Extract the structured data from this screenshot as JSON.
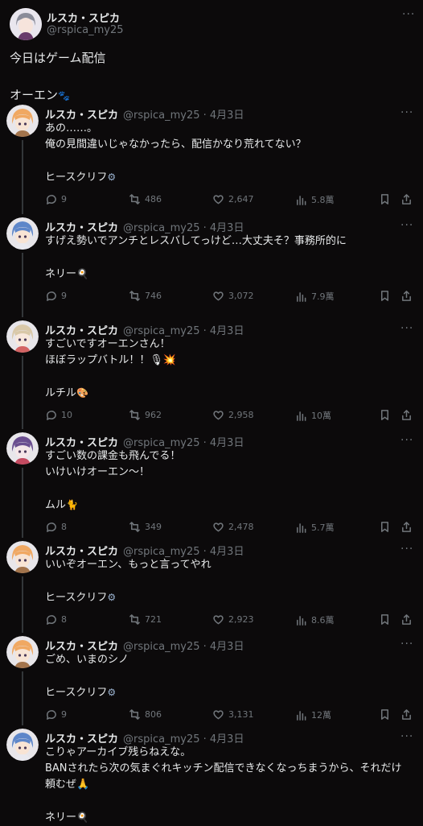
{
  "main": {
    "name": "ルスカ・スピカ",
    "handle": "@rspica_my25",
    "line1": "今日はゲーム配信",
    "line2": "オーエン",
    "line2_emoji": "🐾"
  },
  "replies": [
    {
      "name": "ルスカ・スピカ",
      "meta": "@rspica_my25 · 4月3日",
      "lines": [
        "あの……。",
        "俺の見間違いじゃなかったら、配信かなり荒れてない？"
      ],
      "sig": "ヒースクリフ",
      "sig_icon": "gear-icon",
      "sig_glyph": "⚙",
      "counts": {
        "reply": "9",
        "repost": "486",
        "like": "2,647",
        "views": "5.8萬"
      }
    },
    {
      "name": "ルスカ・スピカ",
      "meta": "@rspica_my25 · 4月3日",
      "lines": [
        "すげえ勢いでアンチとレスバしてっけど…大丈夫そ？事務所的に"
      ],
      "sig": "ネリー",
      "sig_icon": "fried-egg-icon",
      "sig_glyph": "🍳",
      "counts": {
        "reply": "9",
        "repost": "746",
        "like": "3,072",
        "views": "7.9萬"
      }
    },
    {
      "name": "ルスカ・スピカ",
      "meta": "@rspica_my25 · 4月3日",
      "lines": [
        "すごいですオーエンさん！",
        "ほぼラップバトル！！🎙💥"
      ],
      "sig": "ルチル",
      "sig_icon": "palette-icon",
      "sig_glyph": "🎨",
      "counts": {
        "reply": "10",
        "repost": "962",
        "like": "2,958",
        "views": "10萬"
      }
    },
    {
      "name": "ルスカ・スピカ",
      "meta": "@rspica_my25 · 4月3日",
      "lines": [
        "すごい数の課金も飛んでる！",
        "いけいけオーエン〜！"
      ],
      "sig": "ムル",
      "sig_icon": "black-cat-icon",
      "sig_glyph": "🐈",
      "counts": {
        "reply": "8",
        "repost": "349",
        "like": "2,478",
        "views": "5.7萬"
      }
    },
    {
      "name": "ルスカ・スピカ",
      "meta": "@rspica_my25 · 4月3日",
      "lines": [
        "いいぞオーエン、もっと言ってやれ"
      ],
      "sig": "ヒースクリフ",
      "sig_icon": "gear-icon",
      "sig_glyph": "⚙",
      "counts": {
        "reply": "8",
        "repost": "721",
        "like": "2,923",
        "views": "8.6萬"
      }
    },
    {
      "name": "ルスカ・スピカ",
      "meta": "@rspica_my25 · 4月3日",
      "lines": [
        "ごめ、いまのシノ"
      ],
      "sig": "ヒースクリフ",
      "sig_icon": "gear-icon",
      "sig_glyph": "⚙",
      "counts": {
        "reply": "9",
        "repost": "806",
        "like": "3,131",
        "views": "12萬"
      }
    },
    {
      "name": "ルスカ・スピカ",
      "meta": "@rspica_my25 · 4月3日",
      "lines": [
        "こりゃアーカイブ残らねえな。",
        "BANされたら次の気まぐれキッチン配信できなくなっちまうから、それだけ",
        "頼むぜ🙏"
      ],
      "sig": "ネリー",
      "sig_icon": "fried-egg-icon",
      "sig_glyph": "🍳",
      "counts": {
        "reply": "",
        "repost": "",
        "like": "",
        "views": ""
      }
    }
  ],
  "colors": {
    "background": "#0c0a0b",
    "text": "#e7e9ea",
    "muted": "#71767b",
    "thread_line": "#333639"
  }
}
